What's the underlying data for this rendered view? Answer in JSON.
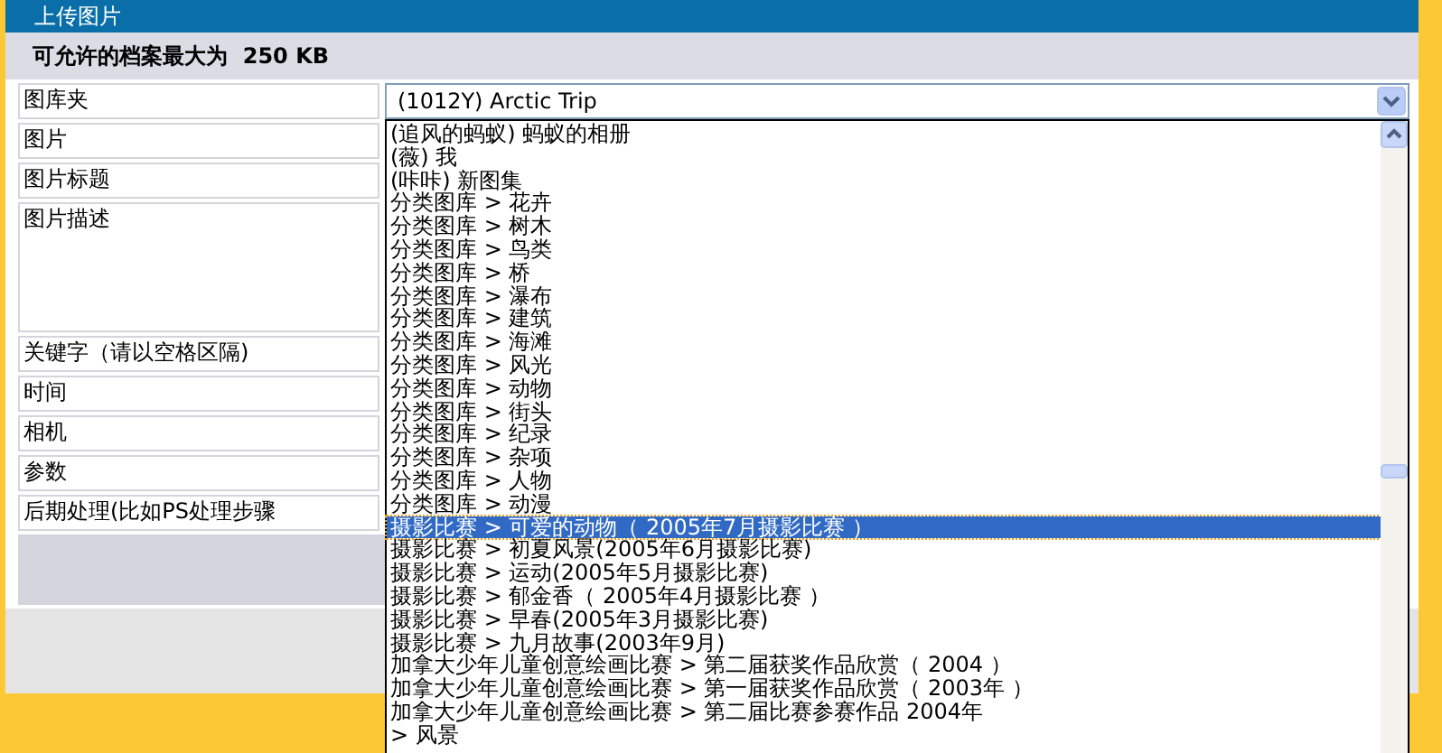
{
  "header": {
    "title": "上传图片"
  },
  "notice": "可允许的档案最大为  250 KB",
  "form": {
    "labels": [
      "图库夹",
      "图片",
      "图片标题",
      "图片描述",
      "关键字（请以空格区隔)",
      "时间",
      "相机",
      "参数",
      "后期处理(比如PS处理步骤"
    ]
  },
  "album_select": {
    "value": "(1012Y) Arctic Trip",
    "expanded": true,
    "options": [
      {
        "label": "(追风的蚂蚁) 蚂蚁的相册",
        "selected": false
      },
      {
        "label": "(薇) 我",
        "selected": false
      },
      {
        "label": "(咔咔) 新图集",
        "selected": false
      },
      {
        "label": "分类图库  > 花卉",
        "selected": false
      },
      {
        "label": "分类图库  > 树木",
        "selected": false
      },
      {
        "label": "分类图库  > 鸟类",
        "selected": false
      },
      {
        "label": "分类图库  > 桥",
        "selected": false
      },
      {
        "label": "分类图库  > 瀑布",
        "selected": false
      },
      {
        "label": "分类图库  > 建筑",
        "selected": false
      },
      {
        "label": "分类图库  > 海滩",
        "selected": false
      },
      {
        "label": "分类图库  > 风光",
        "selected": false
      },
      {
        "label": "分类图库  > 动物",
        "selected": false
      },
      {
        "label": "分类图库  > 街头",
        "selected": false
      },
      {
        "label": "分类图库  > 纪录",
        "selected": false
      },
      {
        "label": "分类图库  > 杂项",
        "selected": false
      },
      {
        "label": "分类图库  > 人物",
        "selected": false
      },
      {
        "label": "分类图库  > 动漫",
        "selected": false
      },
      {
        "label": "摄影比赛  > 可爱的动物（ 2005年7月摄影比赛 ）",
        "selected": true
      },
      {
        "label": "摄影比赛  > 初夏风景(2005年6月摄影比赛)",
        "selected": false
      },
      {
        "label": "摄影比赛  > 运动(2005年5月摄影比赛)",
        "selected": false
      },
      {
        "label": "摄影比赛  > 郁金香（ 2005年4月摄影比赛 ）",
        "selected": false
      },
      {
        "label": "摄影比赛  > 早春(2005年3月摄影比赛)",
        "selected": false
      },
      {
        "label": "摄影比赛  > 九月故事(2003年9月)",
        "selected": false
      },
      {
        "label": "加拿大少年儿童创意绘画比赛  > 第二届获奖作品欣赏（ 2004 ）",
        "selected": false
      },
      {
        "label": "加拿大少年儿童创意绘画比赛  > 第一届获奖作品欣赏（ 2003年 ）",
        "selected": false
      },
      {
        "label": "加拿大少年儿童创意绘画比赛  > 第二届比赛参赛作品 2004年",
        "selected": false
      },
      {
        "label": "> 风景",
        "selected": false
      }
    ]
  }
}
